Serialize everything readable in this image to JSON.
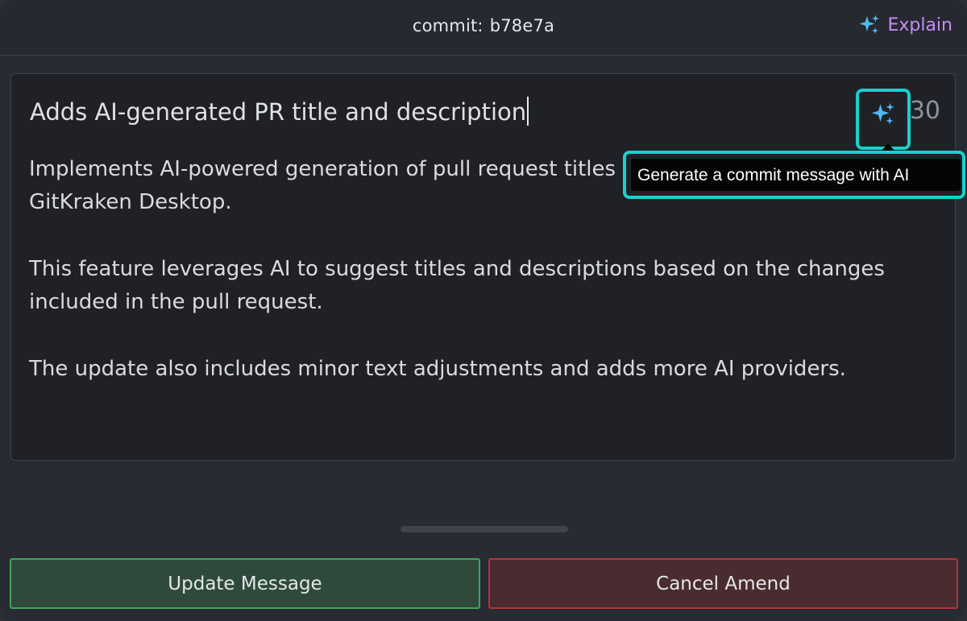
{
  "header": {
    "commit_label": "commit:",
    "commit_hash": "b78e7a",
    "explain_label": "Explain"
  },
  "editor": {
    "summary": "Adds AI-generated PR title and description",
    "char_count": "30",
    "body": [
      "Implements AI-powered generation of pull request titles and descriptions within GitKraken Desktop.",
      "This feature leverages AI to suggest titles and descriptions based on the changes included in the pull request.",
      "The update also includes minor text adjustments and adds more AI providers."
    ]
  },
  "tooltip": {
    "text": "Generate a commit message with AI"
  },
  "actions": {
    "update_label": "Update Message",
    "cancel_label": "Cancel Amend"
  },
  "colors": {
    "explain": "#c58cf5",
    "sparkle": "#4fb8f5",
    "highlight": "#18d1cc",
    "update_border": "#3fa55a",
    "cancel_border": "#b0363c"
  },
  "icons": {
    "explain_icon": "sparkles-icon",
    "ai_generate_icon": "sparkles-icon"
  }
}
